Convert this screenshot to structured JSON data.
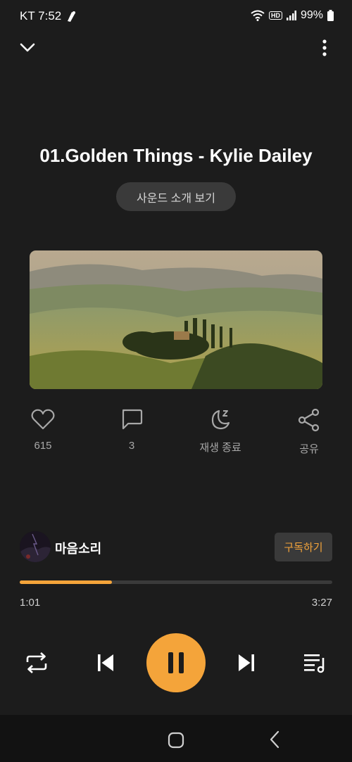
{
  "status_bar": {
    "carrier_time": "KT 7:52",
    "hd": "HD",
    "battery": "99%"
  },
  "track": {
    "title": "01.Golden Things - Kylie Dailey",
    "intro_button": "사운드 소개 보기"
  },
  "actions": [
    {
      "icon": "heart-icon",
      "label": "615"
    },
    {
      "icon": "comment-icon",
      "label": "3"
    },
    {
      "icon": "sleep-timer-icon",
      "label": "재생 종료"
    },
    {
      "icon": "share-icon",
      "label": "공유"
    }
  ],
  "channel": {
    "name": "마음소리",
    "subscribe_label": "구독하기"
  },
  "playback": {
    "current_time": "1:01",
    "total_time": "3:27",
    "progress_fraction": 0.295
  },
  "colors": {
    "accent": "#f4a43a",
    "background": "#1c1c1c",
    "chip": "#3a3a3a"
  }
}
